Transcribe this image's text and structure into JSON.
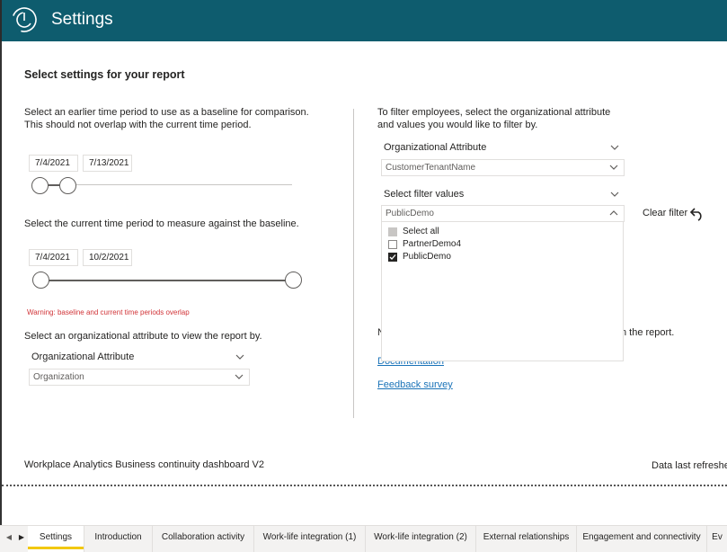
{
  "header": {
    "title": "Settings",
    "logo_icon": "circular-logo-icon"
  },
  "page": {
    "section_title": "Select settings for your report"
  },
  "baseline": {
    "description_line1": "Select an earlier time period to use as a baseline for comparison.",
    "description_line2": "This should not overlap with the current time period.",
    "start_date": "7/4/2021",
    "end_date": "7/13/2021"
  },
  "current": {
    "description": "Select the current time period to measure against the baseline.",
    "start_date": "7/4/2021",
    "end_date": "10/2/2021"
  },
  "warning": "Warning: baseline and current time periods overlap",
  "view_by": {
    "description": "Select an organizational attribute to view the report by.",
    "header_label": "Organizational Attribute",
    "selected_value": "Organization"
  },
  "filter": {
    "description_line1": "To filter employees, select the organizational attribute",
    "description_line2": "and values you would like to filter by.",
    "attribute_header": "Organizational Attribute",
    "attribute_value": "CustomerTenantName",
    "values_header": "Select filter values",
    "values_selected": "PublicDemo",
    "options": [
      {
        "label": "Select all",
        "state": "partial"
      },
      {
        "label": "PartnerDemo4",
        "state": "unchecked"
      },
      {
        "label": "PublicDemo",
        "state": "checked"
      }
    ],
    "clear_label": "Clear filter"
  },
  "info": {
    "hidden_prefix": "N",
    "hidden_suffix": "n the report.",
    "documentation_link": "Documentation",
    "feedback_link": "Feedback survey"
  },
  "footer": {
    "title": "Workplace Analytics Business continuity dashboard V2",
    "data_refreshed": "Data last refreshed"
  },
  "tabs": [
    {
      "label": "Settings",
      "active": true
    },
    {
      "label": "Introduction",
      "active": false
    },
    {
      "label": "Collaboration activity",
      "active": false
    },
    {
      "label": "Work-life integration (1)",
      "active": false
    },
    {
      "label": "Work-life integration (2)",
      "active": false
    },
    {
      "label": "External relationships",
      "active": false
    },
    {
      "label": "Engagement and connectivity",
      "active": false
    },
    {
      "label": "Ev",
      "active": false
    }
  ],
  "colors": {
    "header_bg": "#0e5c6e",
    "link": "#1a73b8",
    "warning": "#d13438",
    "active_tab_accent": "#f2c811"
  }
}
